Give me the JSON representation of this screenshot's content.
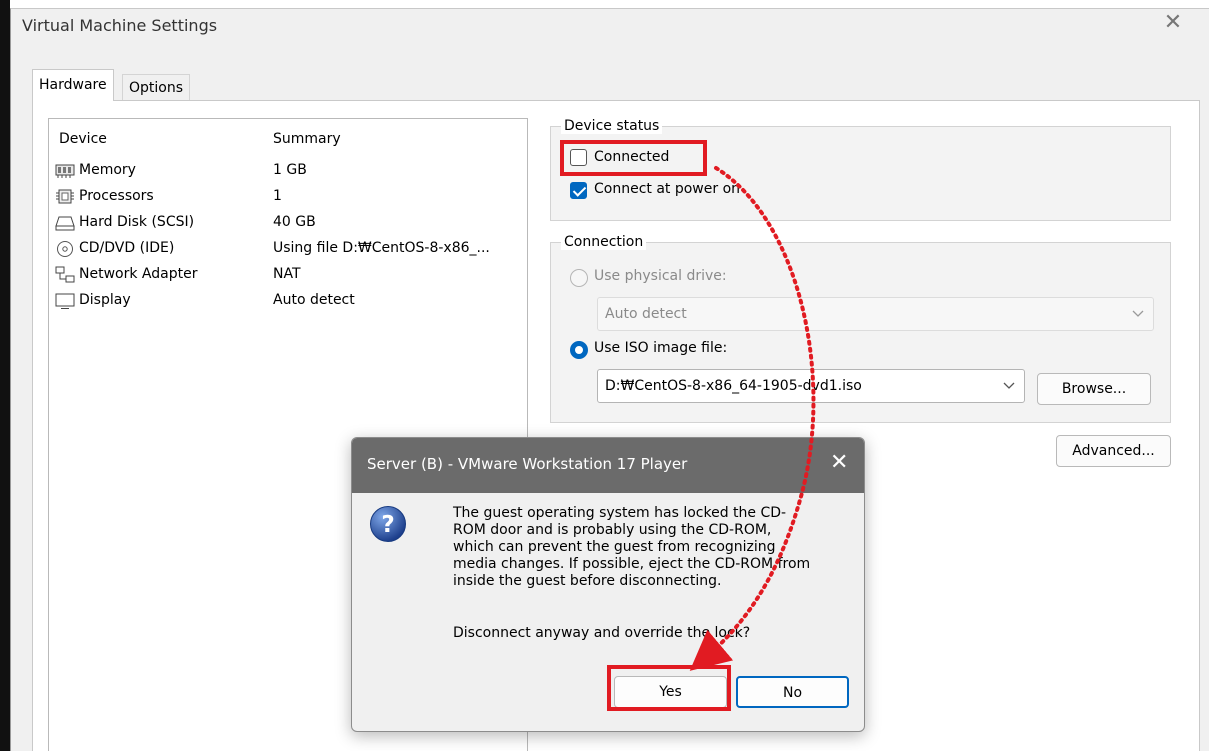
{
  "window": {
    "title": "Virtual Machine Settings",
    "close_glyph": "✕"
  },
  "tabs": [
    {
      "label": "Hardware"
    },
    {
      "label": "Options"
    }
  ],
  "device_list": {
    "headers": {
      "device": "Device",
      "summary": "Summary"
    },
    "items": [
      {
        "name": "Memory",
        "summary": "1 GB",
        "icon": "memory-icon"
      },
      {
        "name": "Processors",
        "summary": "1",
        "icon": "processor-icon"
      },
      {
        "name": "Hard Disk (SCSI)",
        "summary": "40 GB",
        "icon": "hard-disk-icon"
      },
      {
        "name": "CD/DVD (IDE)",
        "summary": "Using file D:₩CentOS-8-x86_...",
        "icon": "cd-dvd-icon"
      },
      {
        "name": "Network Adapter",
        "summary": "NAT",
        "icon": "network-adapter-icon"
      },
      {
        "name": "Display",
        "summary": "Auto detect",
        "icon": "display-icon"
      }
    ]
  },
  "device_status": {
    "legend": "Device status",
    "connected": {
      "label": "Connected",
      "checked": false
    },
    "connect_at_power_on": {
      "label": "Connect at power on",
      "checked": true
    }
  },
  "connection": {
    "legend": "Connection",
    "use_physical_drive": {
      "label": "Use physical drive:",
      "selected": false
    },
    "physical_drive_value": "Auto detect",
    "use_iso": {
      "label": "Use ISO image file:",
      "selected": true
    },
    "iso_path": "D:₩CentOS-8-x86_64-1905-dvd1.iso",
    "browse_label": "Browse..."
  },
  "advanced_label": "Advanced...",
  "dialog": {
    "title": "Server (B) - VMware Workstation 17 Player",
    "close_glyph": "✕",
    "icon": "question-icon",
    "message_lines": [
      "The guest operating system has locked the CD-",
      "ROM door and is probably using the CD-ROM,",
      "which can prevent the guest from recognizing",
      "media changes. If possible, eject the CD-ROM from",
      "inside the guest before disconnecting."
    ],
    "question": "Disconnect anyway and override the lock?",
    "yes_label": "Yes",
    "no_label": "No"
  },
  "colors": {
    "accent": "#0067c0",
    "highlight": "#e11b22",
    "dialog_titlebar": "#6b6b6b"
  }
}
